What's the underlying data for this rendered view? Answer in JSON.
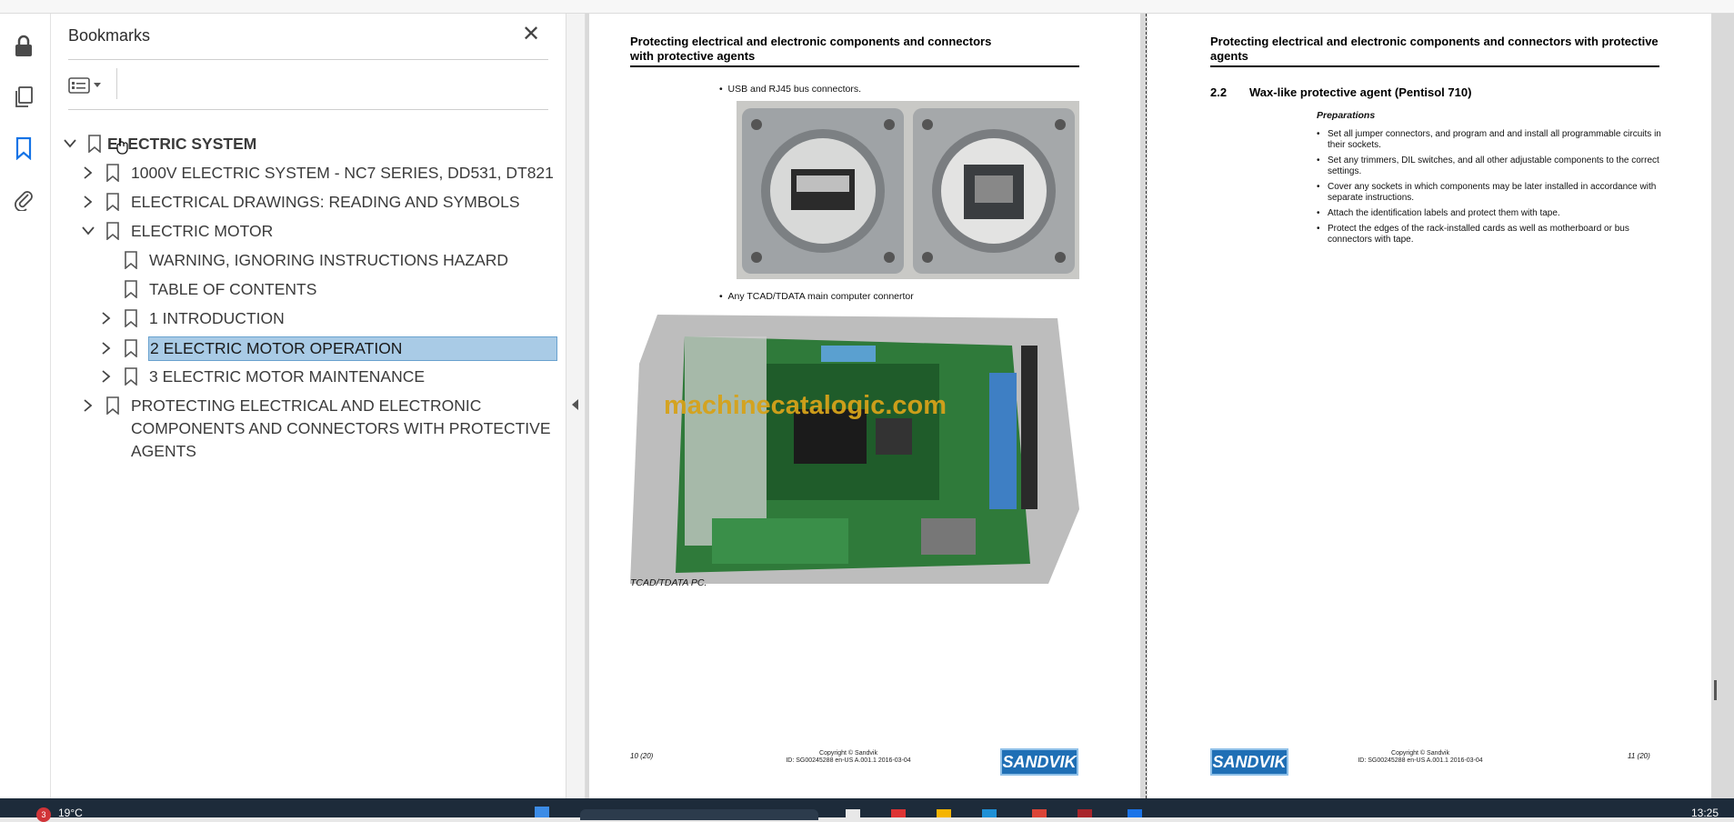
{
  "sidebar": {
    "title": "Bookmarks",
    "items": [
      {
        "label": "ELECTRIC SYSTEM",
        "level": 0,
        "expanded": true
      },
      {
        "label": "1000V ELECTRIC SYSTEM - NC7 SERIES, DD531, DT821",
        "level": 1,
        "expanded": false
      },
      {
        "label": "ELECTRICAL DRAWINGS: READING AND SYMBOLS",
        "level": 1,
        "expanded": false
      },
      {
        "label": "ELECTRIC MOTOR",
        "level": 1,
        "expanded": true
      },
      {
        "label": "WARNING, IGNORING INSTRUCTIONS HAZARD",
        "level": 2
      },
      {
        "label": "TABLE OF CONTENTS",
        "level": 2
      },
      {
        "label": "1 INTRODUCTION",
        "level": 2,
        "expanded": false
      },
      {
        "label": "2 ELECTRIC MOTOR OPERATION",
        "level": 2,
        "expanded": false,
        "selected": true
      },
      {
        "label": "3 ELECTRIC MOTOR MAINTENANCE",
        "level": 2,
        "expanded": false
      },
      {
        "label": "PROTECTING ELECTRICAL AND ELECTRONIC",
        "label2": "COMPONENTS AND CONNECTORS WITH PROTECTIVE",
        "label3": "AGENTS",
        "level": 1,
        "expanded": false
      }
    ]
  },
  "left_page": {
    "header": "Protecting electrical and electronic components and connectors with protective agents",
    "bullet1": "USB and RJ45 bus connectors.",
    "bullet2": "Any TCAD/TDATA main computer connertor",
    "watermark": "machinecatalogic.com",
    "caption": "TCAD/TDATA PC.",
    "page_num": "10 (20)",
    "copyright": "Copyright © Sandvik",
    "doc_id": "ID: SG00245288 en-US A.001.1 2016-03-04",
    "logo": "SANDVIK"
  },
  "right_page": {
    "header": "Protecting electrical and electronic components and connectors with protective agents",
    "section_num": "2.2",
    "section_title": "Wax-like protective agent (Pentisol 710)",
    "subheading": "Preparations",
    "bullets": [
      "Set all jumper connectors, and program and and install all programmable circuits in their sockets.",
      "Set any trimmers, DIL switches, and all other adjustable components to the correct settings.",
      "Cover any sockets in which components may be later installed in accordance with separate instructions.",
      "Attach the identification labels and protect them with tape.",
      "Protect the edges of the rack-installed cards as well as motherboard or bus connectors with tape."
    ],
    "page_num": "11 (20)",
    "copyright": "Copyright © Sandvik",
    "doc_id": "ID: SG00245288 en-US A.001.1 2016-03-04",
    "logo": "SANDVIK"
  },
  "taskbar": {
    "badge": "3",
    "weather": "19°C",
    "clock": "13:25"
  },
  "colors": {
    "selection": "#a9cbe6",
    "accent": "#1f6fb5",
    "watermark": "#d6a21a"
  }
}
